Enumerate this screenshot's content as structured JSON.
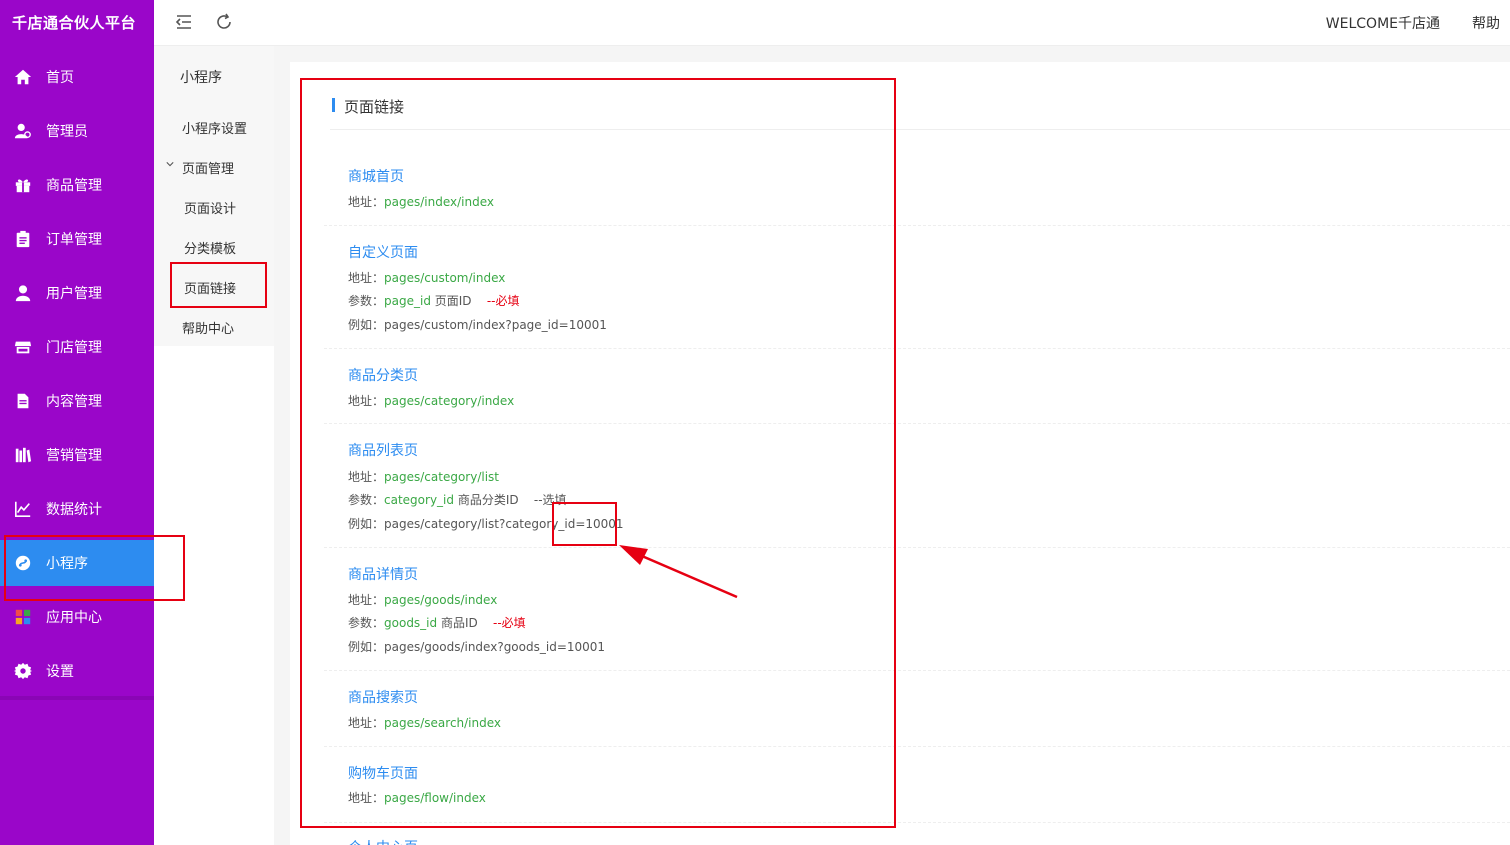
{
  "app": {
    "brand": "千店通合伙人平台"
  },
  "sidebar": {
    "items": [
      {
        "label": "首页",
        "icon": "home-icon"
      },
      {
        "label": "管理员",
        "icon": "admin-icon"
      },
      {
        "label": "商品管理",
        "icon": "gift-icon"
      },
      {
        "label": "订单管理",
        "icon": "clipboard-icon"
      },
      {
        "label": "用户管理",
        "icon": "user-icon"
      },
      {
        "label": "门店管理",
        "icon": "store-icon"
      },
      {
        "label": "内容管理",
        "icon": "document-icon"
      },
      {
        "label": "营销管理",
        "icon": "books-icon"
      },
      {
        "label": "数据统计",
        "icon": "chart-icon"
      },
      {
        "label": "小程序",
        "icon": "miniprogram-icon"
      },
      {
        "label": "应用中心",
        "icon": "apps-icon"
      },
      {
        "label": "设置",
        "icon": "gear-icon"
      }
    ],
    "active_index": 9,
    "colors": {
      "background": "#9a06c9",
      "active": "#2d8cf0"
    }
  },
  "submenu": {
    "title": "小程序",
    "items": [
      "小程序设置",
      "页面管理",
      "页面设计",
      "分类模板",
      "页面链接",
      "帮助中心"
    ]
  },
  "topbar": {
    "welcome": "WELCOME千店通",
    "help": "帮助"
  },
  "main": {
    "section_title": "页面链接",
    "address_label": "地址：",
    "param_label": "参数：",
    "example_label": "例如：",
    "links": [
      {
        "title": "商城首页",
        "address": "pages/index/index"
      },
      {
        "title": "自定义页面",
        "address": "pages/custom/index",
        "param_key": "page_id",
        "param_desc": "页面ID",
        "param_flag": "--必填",
        "example": "pages/custom/index?page_id=10001"
      },
      {
        "title": "商品分类页",
        "address": "pages/category/index"
      },
      {
        "title": "商品列表页",
        "address": "pages/category/list",
        "param_key": "category_id",
        "param_desc": "商品分类ID",
        "param_flag": "--选填",
        "example": "pages/category/list?category_id=10001"
      },
      {
        "title": "商品详情页",
        "address": "pages/goods/index",
        "param_key": "goods_id",
        "param_desc": "商品ID",
        "param_flag": "--必填",
        "example": "pages/goods/index?goods_id=10001"
      },
      {
        "title": "商品搜索页",
        "address": "pages/search/index"
      },
      {
        "title": "购物车页面",
        "address": "pages/flow/index"
      },
      {
        "title": "个人中心页"
      }
    ],
    "colors": {
      "link_title": "#2d8cf0",
      "address": "#3aa845",
      "required": "#e60012"
    }
  }
}
